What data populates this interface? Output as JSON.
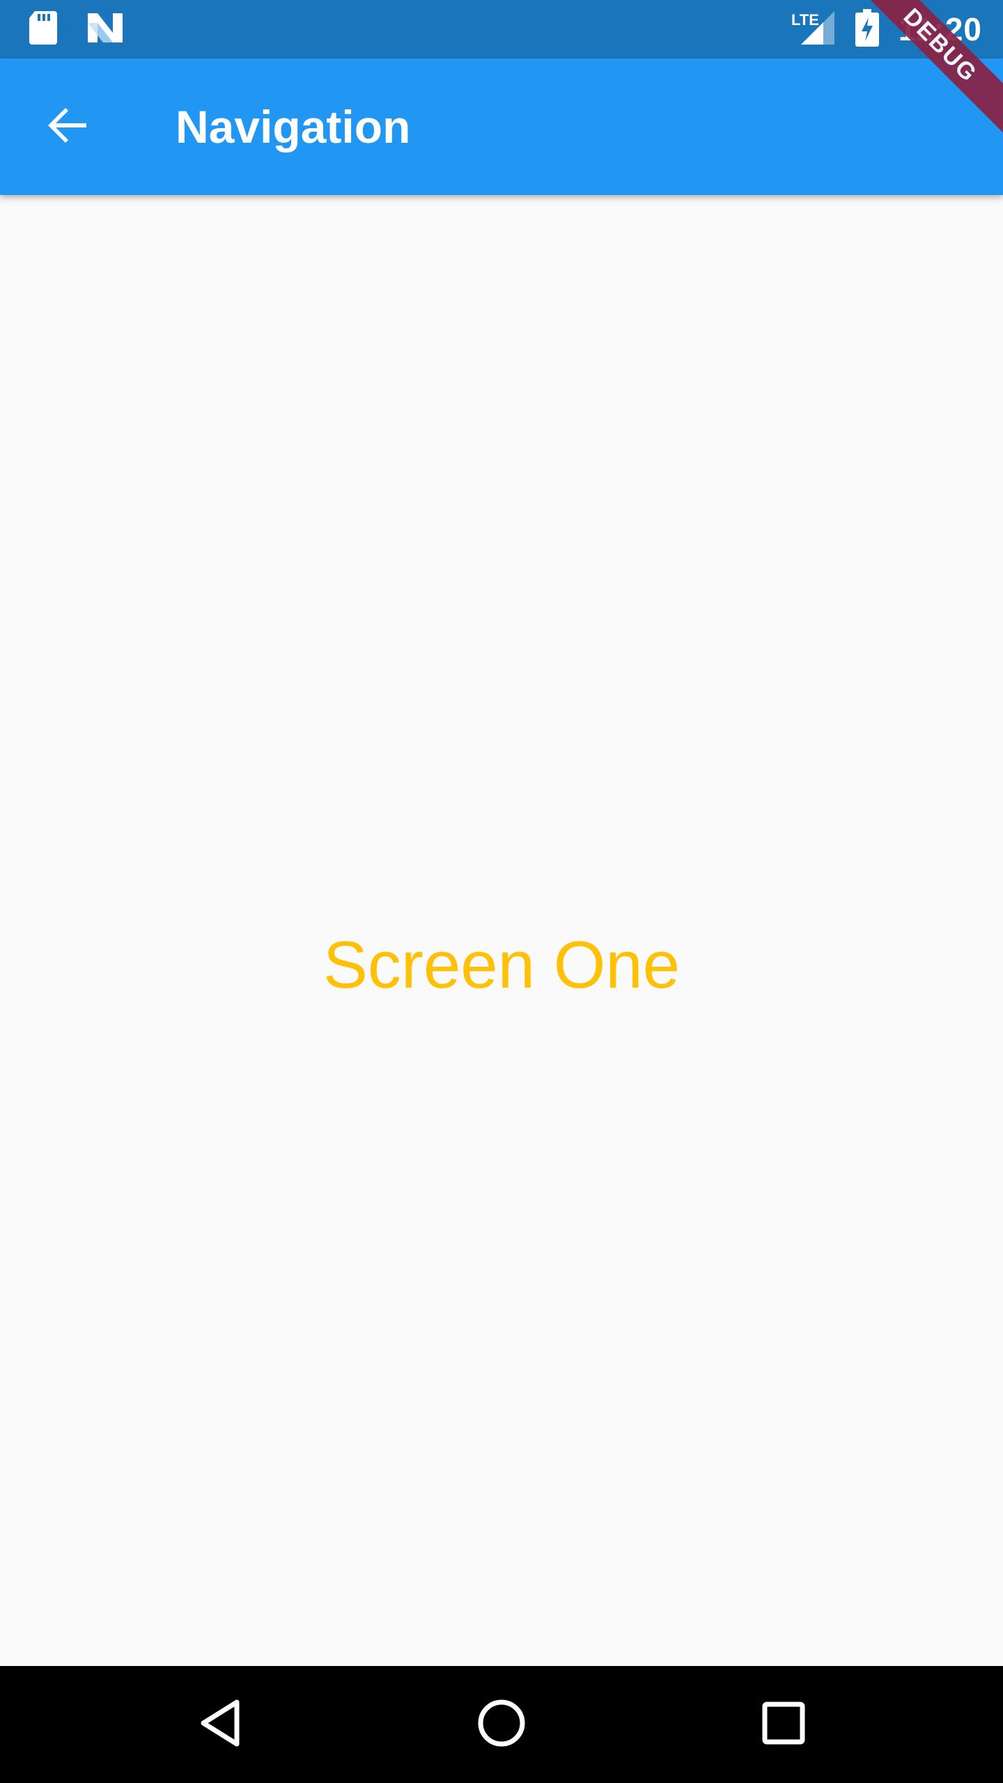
{
  "status_bar": {
    "time": "11:20",
    "network_label": "LTE",
    "icons": [
      "sd-card-icon",
      "n-notification-icon",
      "lte-signal-icon",
      "battery-charging-icon"
    ]
  },
  "app_bar": {
    "title": "Navigation",
    "back_icon": "arrow-back-icon"
  },
  "debug_banner": {
    "label": "DEBUG"
  },
  "main": {
    "text": "Screen One"
  },
  "nav_bar": {
    "buttons": [
      "back-triangle-icon",
      "home-circle-icon",
      "recents-square-icon"
    ]
  },
  "colors": {
    "status_bar": "#1b75bb",
    "app_bar": "#2196f3",
    "background": "#fafafa",
    "screen_text": "#ffc107",
    "debug_banner": "#8a2245",
    "nav_bar": "#000000"
  }
}
